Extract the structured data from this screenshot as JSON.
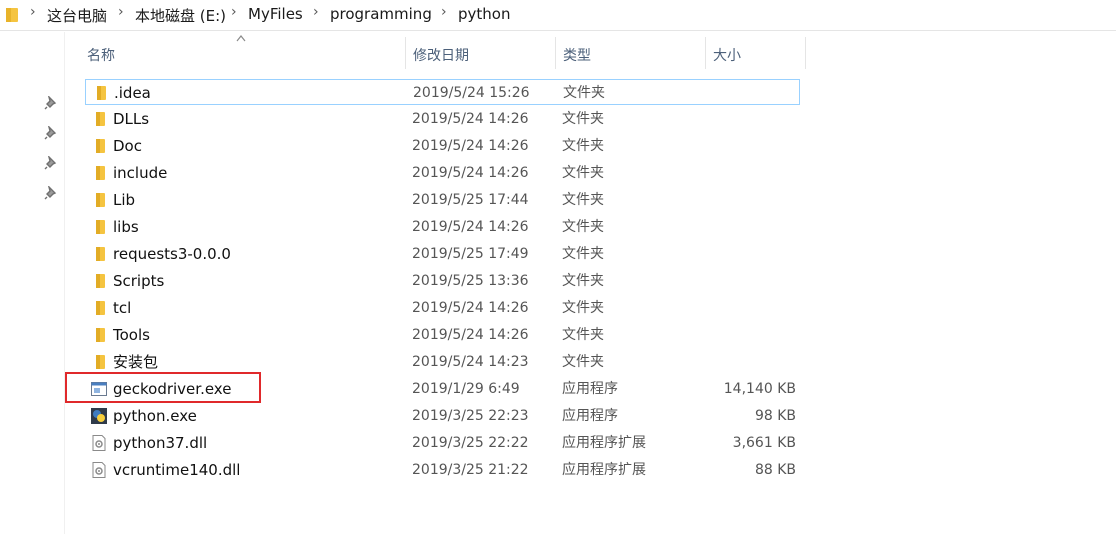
{
  "breadcrumb": [
    "这台电脑",
    "本地磁盘 (E:)",
    "MyFiles",
    "programming",
    "python"
  ],
  "columns": {
    "name": "名称",
    "date": "修改日期",
    "type": "类型",
    "size": "大小"
  },
  "files": [
    {
      "name": ".idea",
      "date": "2019/5/24 15:26",
      "type": "文件夹",
      "size": "",
      "icon": "folder-icon"
    },
    {
      "name": "DLLs",
      "date": "2019/5/24 14:26",
      "type": "文件夹",
      "size": "",
      "icon": "folder-icon"
    },
    {
      "name": "Doc",
      "date": "2019/5/24 14:26",
      "type": "文件夹",
      "size": "",
      "icon": "folder-icon"
    },
    {
      "name": "include",
      "date": "2019/5/24 14:26",
      "type": "文件夹",
      "size": "",
      "icon": "folder-icon"
    },
    {
      "name": "Lib",
      "date": "2019/5/25 17:44",
      "type": "文件夹",
      "size": "",
      "icon": "folder-icon"
    },
    {
      "name": "libs",
      "date": "2019/5/24 14:26",
      "type": "文件夹",
      "size": "",
      "icon": "folder-icon"
    },
    {
      "name": "requests3-0.0.0",
      "date": "2019/5/25 17:49",
      "type": "文件夹",
      "size": "",
      "icon": "folder-icon"
    },
    {
      "name": "Scripts",
      "date": "2019/5/25 13:36",
      "type": "文件夹",
      "size": "",
      "icon": "folder-icon"
    },
    {
      "name": "tcl",
      "date": "2019/5/24 14:26",
      "type": "文件夹",
      "size": "",
      "icon": "folder-icon"
    },
    {
      "name": "Tools",
      "date": "2019/5/24 14:26",
      "type": "文件夹",
      "size": "",
      "icon": "folder-icon"
    },
    {
      "name": "安装包",
      "date": "2019/5/24 14:23",
      "type": "文件夹",
      "size": "",
      "icon": "folder-icon"
    },
    {
      "name": "geckodriver.exe",
      "date": "2019/1/29 6:49",
      "type": "应用程序",
      "size": "14,140 KB",
      "icon": "exe-window-icon"
    },
    {
      "name": "python.exe",
      "date": "2019/3/25 22:23",
      "type": "应用程序",
      "size": "98 KB",
      "icon": "python-icon"
    },
    {
      "name": "python37.dll",
      "date": "2019/3/25 22:22",
      "type": "应用程序扩展",
      "size": "3,661 KB",
      "icon": "dll-gear-icon"
    },
    {
      "name": "vcruntime140.dll",
      "date": "2019/3/25 21:22",
      "type": "应用程序扩展",
      "size": "88 KB",
      "icon": "dll-gear-icon"
    }
  ],
  "selected_index": 0,
  "highlighted_index": 11,
  "colors": {
    "folder": "#f5c440",
    "selection_border": "#99d1ff",
    "highlight": "#e0292b",
    "header_text": "#4c607a"
  }
}
